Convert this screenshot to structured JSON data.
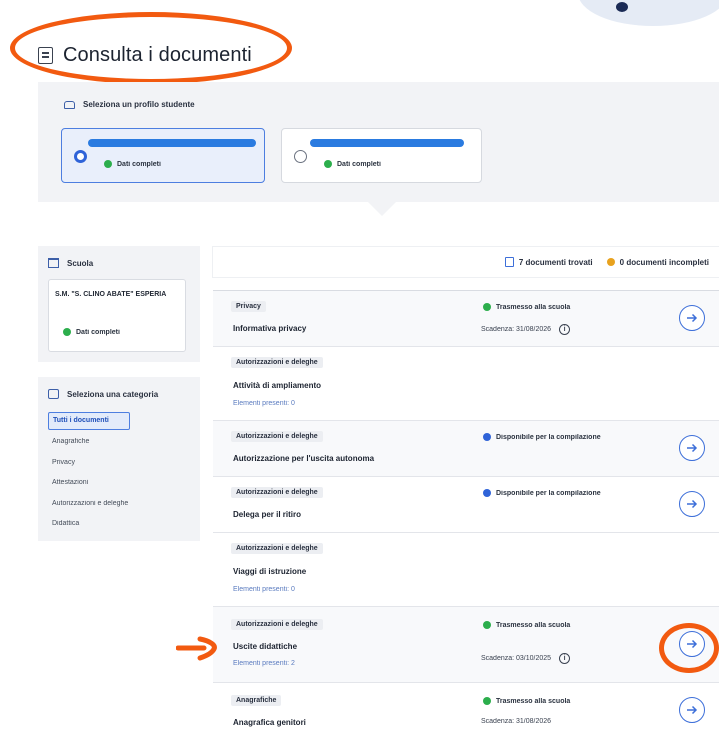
{
  "page": {
    "title": "Consulta i documenti"
  },
  "profiles": {
    "label": "Seleziona un profilo studente",
    "students": [
      {
        "status": "Dati completi",
        "selected": true
      },
      {
        "status": "Dati completi",
        "selected": false
      }
    ]
  },
  "summary": {
    "found": "7 documenti trovati",
    "incomplete": "0 documenti incompleti"
  },
  "school": {
    "heading": "Scuola",
    "name": "S.M. \"S. CLINO ABATE\" ESPERIA",
    "status": "Dati completi"
  },
  "categories": {
    "heading": "Seleziona una categoria",
    "items": [
      "Tutti i documenti",
      "Anagrafiche",
      "Privacy",
      "Attestazioni",
      "Autorizzazioni e deleghe",
      "Didattica"
    ],
    "active_index": 0
  },
  "documents": [
    {
      "tag": "Privacy",
      "title": "Informativa privacy",
      "status": "Trasmesso alla scuola",
      "status_color": "#2cae4c",
      "due": "Scadenza: 31/08/2026"
    },
    {
      "tag": "Autorizzazioni e deleghe",
      "title": "Attività di ampliamento",
      "sub": "Elementi presenti: 0"
    },
    {
      "tag": "Autorizzazioni e deleghe",
      "title": "Autorizzazione per l'uscita autonoma",
      "status": "Disponibile per la compilazione",
      "status_color": "#2f63d8"
    },
    {
      "tag": "Autorizzazioni e deleghe",
      "title": "Delega per il ritiro",
      "status": "Disponibile per la compilazione",
      "status_color": "#2f63d8"
    },
    {
      "tag": "Autorizzazioni e deleghe",
      "title": "Viaggi di istruzione",
      "sub": "Elementi presenti: 0"
    },
    {
      "tag": "Autorizzazioni e deleghe",
      "title": "Uscite didattiche",
      "sub": "Elementi presenti: 2",
      "status": "Trasmesso alla scuola",
      "status_color": "#2cae4c",
      "due": "Scadenza: 03/10/2025"
    },
    {
      "tag": "Anagrafiche",
      "title": "Anagrafica genitori",
      "status": "Trasmesso alla scuola",
      "status_color": "#2cae4c",
      "due": "Scadenza: 31/08/2026"
    }
  ],
  "colors": {
    "accent": "#3d6fd9",
    "annotation": "#f25a10",
    "ok": "#2cae4c",
    "available": "#2f63d8",
    "warning": "#e8a21e"
  }
}
